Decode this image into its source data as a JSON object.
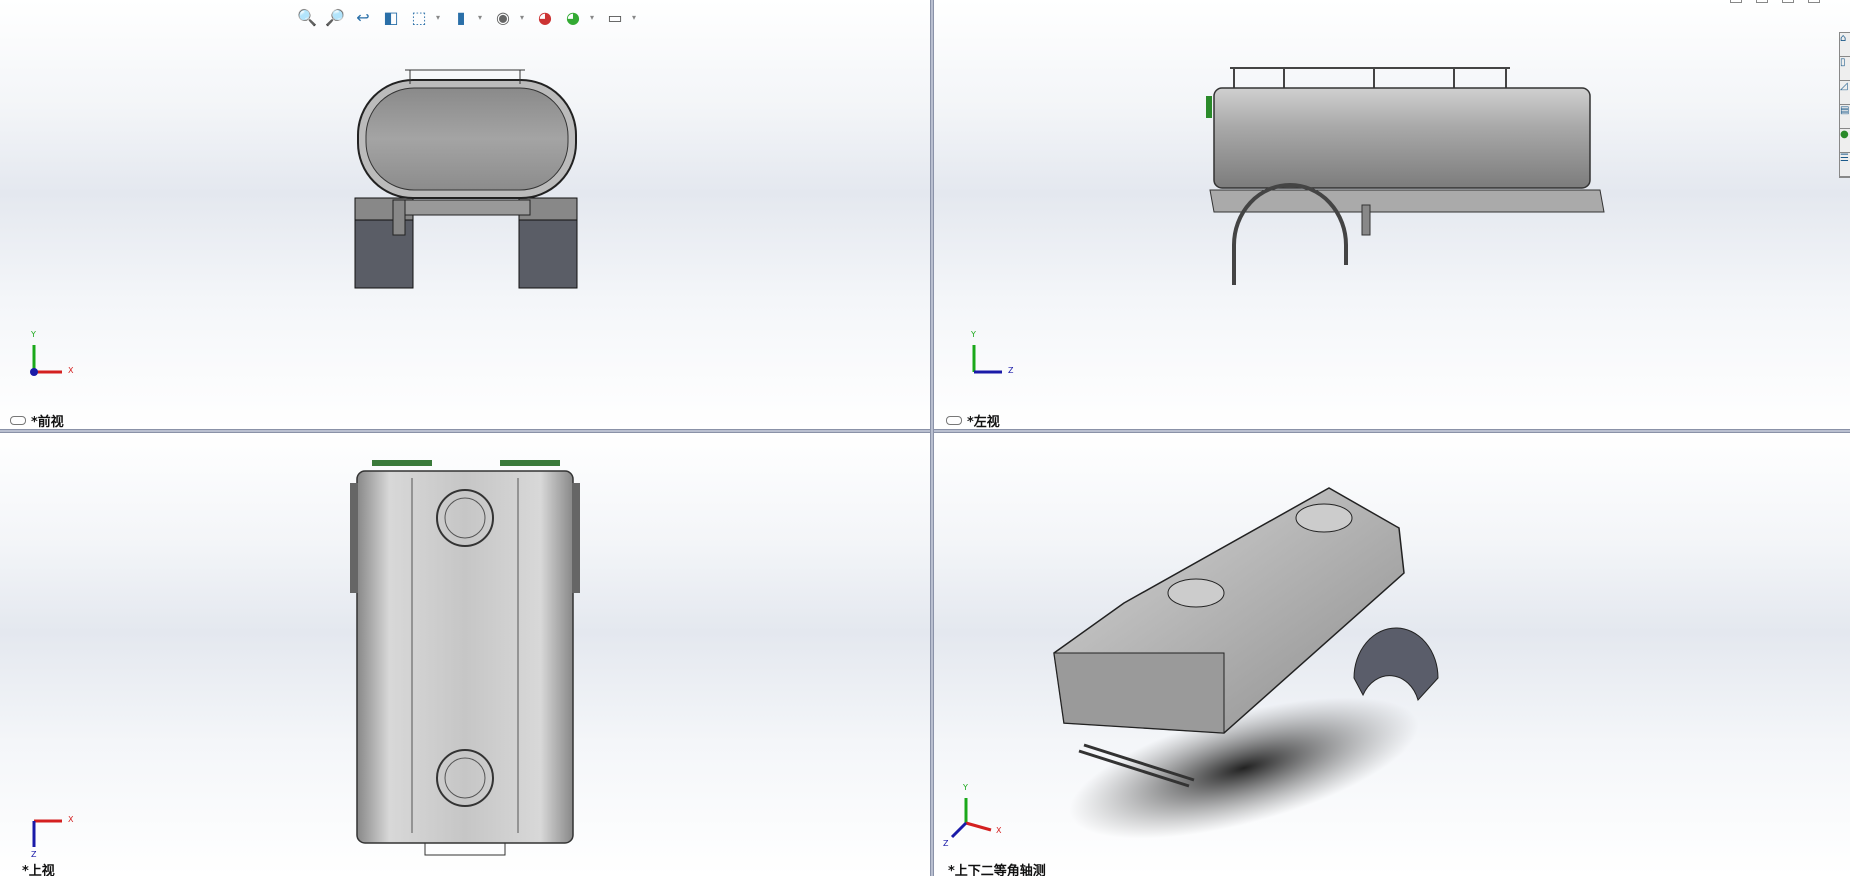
{
  "viewports": {
    "front": {
      "label": "*前视",
      "axes": {
        "up": "Y",
        "right": "X"
      }
    },
    "left": {
      "label": "*左视",
      "axes": {
        "up": "Y",
        "right": "Z"
      }
    },
    "top": {
      "label": "*上视",
      "axes": {
        "right": "X",
        "down": "Z"
      }
    },
    "iso": {
      "label": "*上下二等角轴测",
      "axes": {
        "up": "Y",
        "right": "X",
        "left": "Z"
      }
    }
  },
  "toolbar": {
    "icons": [
      "zoom-to-fit-icon",
      "zoom-to-area-icon",
      "previous-view-icon",
      "section-view-icon",
      "view-orientation-icon",
      "display-style-icon",
      "hide-show-items-icon",
      "edit-appearance-icon",
      "apply-scene-icon",
      "view-settings-icon"
    ]
  },
  "colors": {
    "x_axis": "#d42020",
    "y_axis": "#1aa81a",
    "z_axis": "#1a1aa8",
    "divider": "#b9bfd0",
    "part": "#9a9a9a"
  }
}
